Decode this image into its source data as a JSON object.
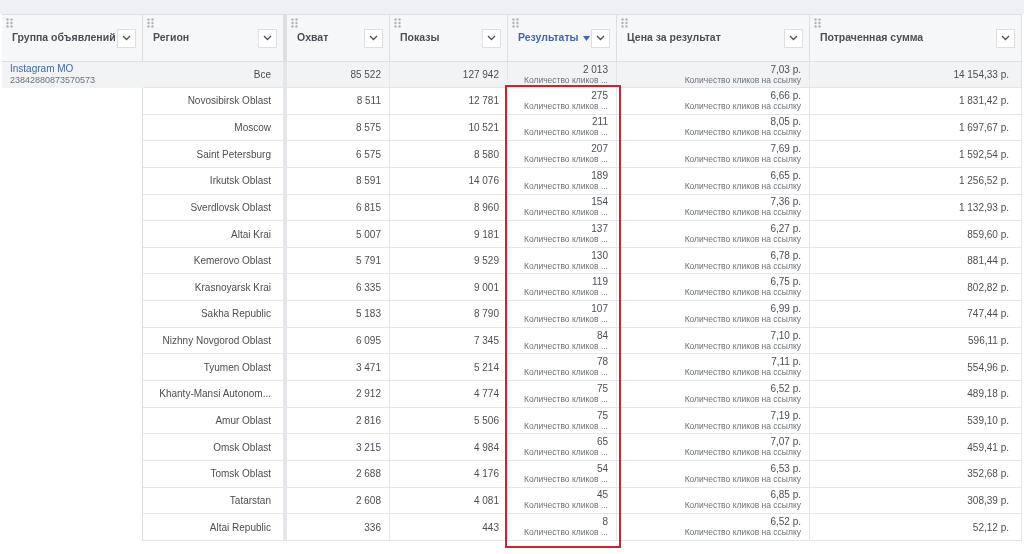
{
  "columns": [
    {
      "label": "Группа объявлений",
      "sorted": false,
      "highlighted": false
    },
    {
      "label": "Регион",
      "sorted": false,
      "highlighted": false
    },
    {
      "label": "Охват",
      "sorted": false,
      "highlighted": false
    },
    {
      "label": "Показы",
      "sorted": false,
      "highlighted": false
    },
    {
      "label": "Результаты",
      "sorted": true,
      "highlighted": true
    },
    {
      "label": "Цена за результат",
      "sorted": false,
      "highlighted": false
    },
    {
      "label": "Потраченная сумма",
      "sorted": false,
      "highlighted": false
    }
  ],
  "group": {
    "name": "Instagram MO",
    "id": "23842880873570573"
  },
  "total": {
    "region": "Все",
    "reach": "85 522",
    "impressions": "127 942",
    "results": "2 013",
    "results_type": "Количество кликов ...",
    "cost": "7,03 р.",
    "cost_type": "Количество кликов на ссылку",
    "spent": "14 154,33 р."
  },
  "rows": [
    {
      "region": "Novosibirsk Oblast",
      "reach": "8 511",
      "impressions": "12 781",
      "results": "275",
      "results_type": "Количество кликов ...",
      "cost": "6,66 р.",
      "cost_type": "Количество кликов на ссылку",
      "spent": "1 831,42 р."
    },
    {
      "region": "Moscow",
      "reach": "8 575",
      "impressions": "10 521",
      "results": "211",
      "results_type": "Количество кликов ...",
      "cost": "8,05 р.",
      "cost_type": "Количество кликов на ссылку",
      "spent": "1 697,67 р."
    },
    {
      "region": "Saint Petersburg",
      "reach": "6 575",
      "impressions": "8 580",
      "results": "207",
      "results_type": "Количество кликов ...",
      "cost": "7,69 р.",
      "cost_type": "Количество кликов на ссылку",
      "spent": "1 592,54 р."
    },
    {
      "region": "Irkutsk Oblast",
      "reach": "8 591",
      "impressions": "14 076",
      "results": "189",
      "results_type": "Количество кликов ...",
      "cost": "6,65 р.",
      "cost_type": "Количество кликов на ссылку",
      "spent": "1 256,52 р."
    },
    {
      "region": "Sverdlovsk Oblast",
      "reach": "6 815",
      "impressions": "8 960",
      "results": "154",
      "results_type": "Количество кликов ...",
      "cost": "7,36 р.",
      "cost_type": "Количество кликов на ссылку",
      "spent": "1 132,93 р."
    },
    {
      "region": "Altai Krai",
      "reach": "5 007",
      "impressions": "9 181",
      "results": "137",
      "results_type": "Количество кликов ...",
      "cost": "6,27 р.",
      "cost_type": "Количество кликов на ссылку",
      "spent": "859,60 р."
    },
    {
      "region": "Kemerovo Oblast",
      "reach": "5 791",
      "impressions": "9 529",
      "results": "130",
      "results_type": "Количество кликов ...",
      "cost": "6,78 р.",
      "cost_type": "Количество кликов на ссылку",
      "spent": "881,44 р."
    },
    {
      "region": "Krasnoyarsk Krai",
      "reach": "6 335",
      "impressions": "9 001",
      "results": "119",
      "results_type": "Количество кликов ...",
      "cost": "6,75 р.",
      "cost_type": "Количество кликов на ссылку",
      "spent": "802,82 р."
    },
    {
      "region": "Sakha Republic",
      "reach": "5 183",
      "impressions": "8 790",
      "results": "107",
      "results_type": "Количество кликов ...",
      "cost": "6,99 р.",
      "cost_type": "Количество кликов на ссылку",
      "spent": "747,44 р."
    },
    {
      "region": "Nizhny Novgorod Oblast",
      "reach": "6 095",
      "impressions": "7 345",
      "results": "84",
      "results_type": "Количество кликов ...",
      "cost": "7,10 р.",
      "cost_type": "Количество кликов на ссылку",
      "spent": "596,11 р."
    },
    {
      "region": "Tyumen Oblast",
      "reach": "3 471",
      "impressions": "5 214",
      "results": "78",
      "results_type": "Количество кликов ...",
      "cost": "7,11 р.",
      "cost_type": "Количество кликов на ссылку",
      "spent": "554,96 р."
    },
    {
      "region": "Khanty-Mansi Autonom...",
      "reach": "2 912",
      "impressions": "4 774",
      "results": "75",
      "results_type": "Количество кликов ...",
      "cost": "6,52 р.",
      "cost_type": "Количество кликов на ссылку",
      "spent": "489,18 р."
    },
    {
      "region": "Amur Oblast",
      "reach": "2 816",
      "impressions": "5 506",
      "results": "75",
      "results_type": "Количество кликов ...",
      "cost": "7,19 р.",
      "cost_type": "Количество кликов на ссылку",
      "spent": "539,10 р."
    },
    {
      "region": "Omsk Oblast",
      "reach": "3 215",
      "impressions": "4 984",
      "results": "65",
      "results_type": "Количество кликов ...",
      "cost": "7,07 р.",
      "cost_type": "Количество кликов на ссылку",
      "spent": "459,41 р."
    },
    {
      "region": "Tomsk Oblast",
      "reach": "2 688",
      "impressions": "4 176",
      "results": "54",
      "results_type": "Количество кликов ...",
      "cost": "6,53 р.",
      "cost_type": "Количество кликов на ссылку",
      "spent": "352,68 р."
    },
    {
      "region": "Tatarstan",
      "reach": "2 608",
      "impressions": "4 081",
      "results": "45",
      "results_type": "Количество кликов ...",
      "cost": "6,85 р.",
      "cost_type": "Количество кликов на ссылку",
      "spent": "308,39 р."
    },
    {
      "region": "Altai Republic",
      "reach": "336",
      "impressions": "443",
      "results": "8",
      "results_type": "Количество кликов ...",
      "cost": "6,52 р.",
      "cost_type": "Количество кликов на ссылку",
      "spent": "52,12 р."
    }
  ]
}
